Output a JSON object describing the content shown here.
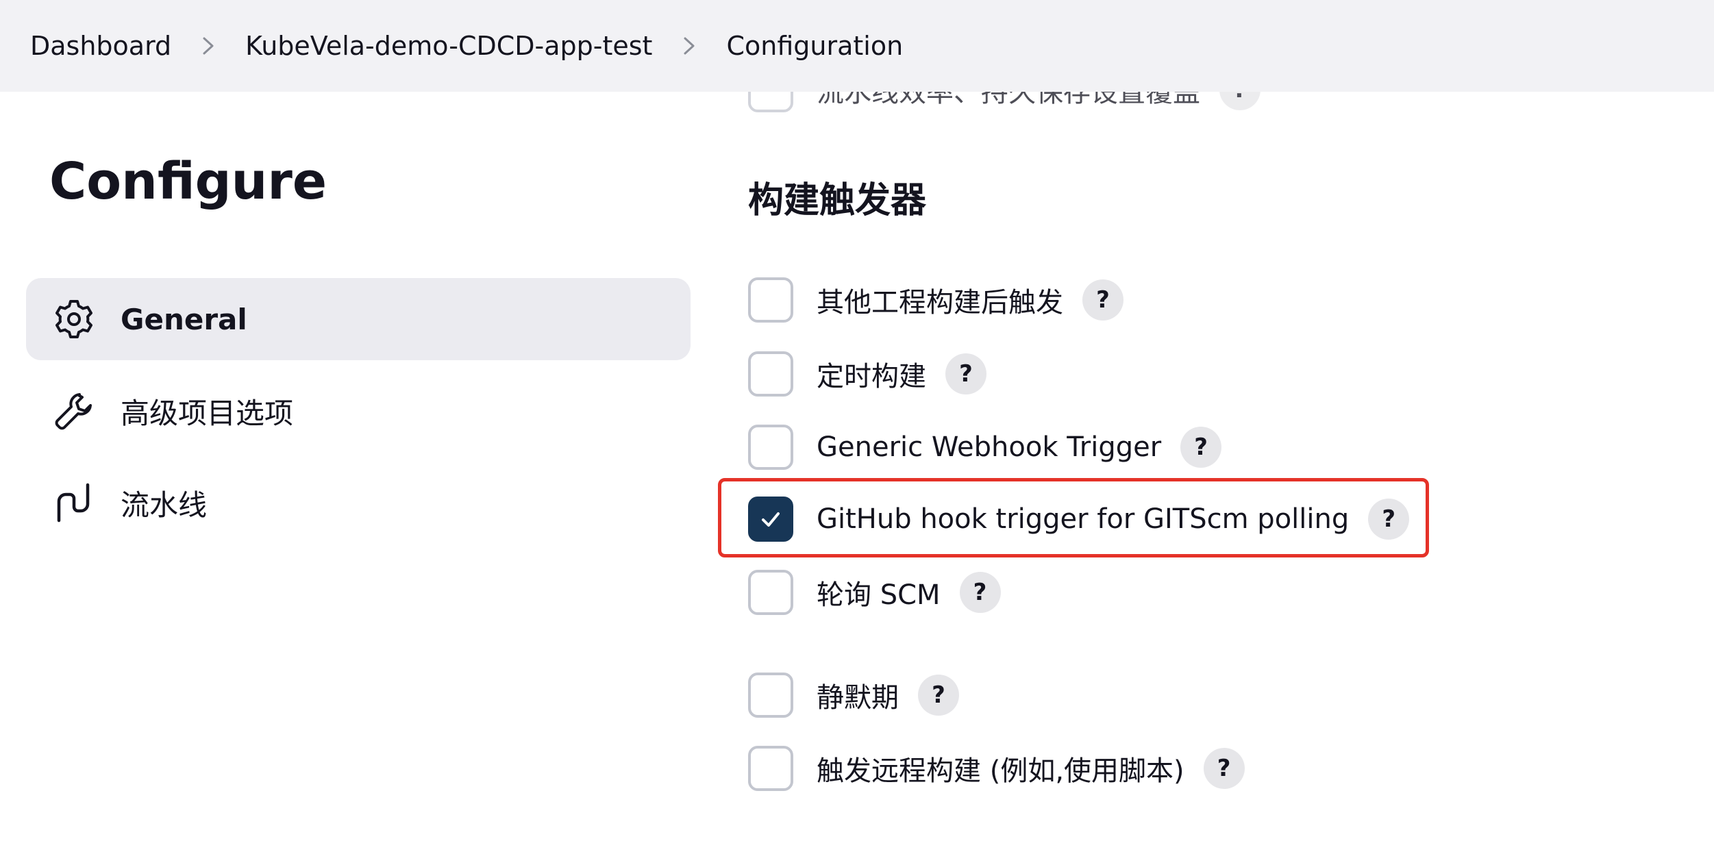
{
  "breadcrumb": {
    "items": [
      "Dashboard",
      "KubeVela-demo-CDCD-app-test",
      "Configuration"
    ]
  },
  "sidebar": {
    "title": "Configure",
    "items": [
      {
        "label": "General",
        "icon": "gear-icon",
        "active": true
      },
      {
        "label": "高级项目选项",
        "icon": "wrench-icon",
        "active": false
      },
      {
        "label": "流水线",
        "icon": "pipeline-icon",
        "active": false
      }
    ]
  },
  "main": {
    "partial_option": {
      "label": "流水线效率、持久保存设置覆盖",
      "checked": false
    },
    "section_title": "构建触发器",
    "options": [
      {
        "label": "其他工程构建后触发",
        "checked": false
      },
      {
        "label": "定时构建",
        "checked": false
      },
      {
        "label": "Generic Webhook Trigger",
        "checked": false
      },
      {
        "label": "GitHub hook trigger for GITScm polling",
        "checked": true
      },
      {
        "label": "轮询 SCM",
        "checked": false
      },
      {
        "label": "静默期",
        "checked": false
      },
      {
        "label": "触发远程构建 (例如,使用脚本)",
        "checked": false
      }
    ],
    "help_label": "?"
  },
  "colors": {
    "checked": "#173656",
    "highlight": "#e53228",
    "topbar": "#f2f2f5",
    "active_item": "#ebebf0"
  }
}
